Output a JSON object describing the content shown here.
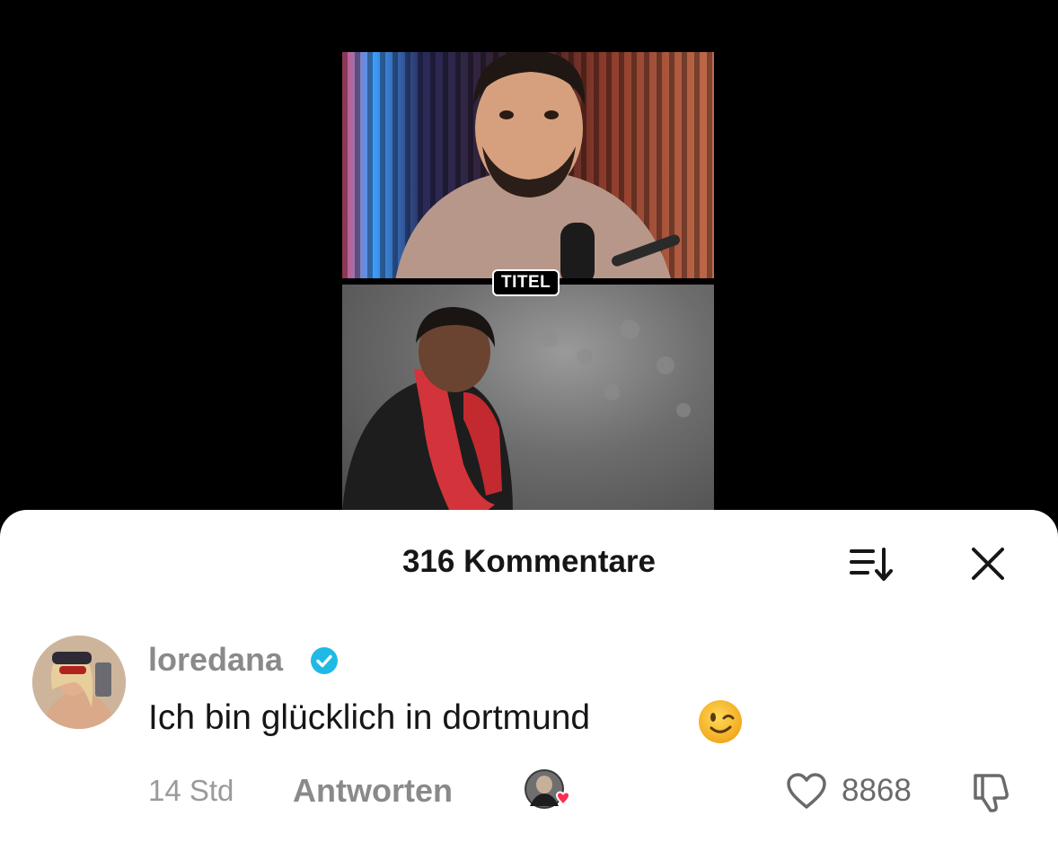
{
  "video": {
    "overlay_label": "TITEL"
  },
  "comments_sheet": {
    "title": "316 Kommentare",
    "sort_icon": "sort-icon",
    "close_icon": "close-icon"
  },
  "comment": {
    "username": "loredana",
    "verified": true,
    "text": "Ich bin glücklich in dortmund",
    "emoji": "winking-face-emoji",
    "time": "14 Std",
    "reply_label": "Antworten",
    "likes": "8868",
    "colors": {
      "verified_badge": "#20b9e6",
      "creator_heart": "#fe2c55"
    }
  }
}
